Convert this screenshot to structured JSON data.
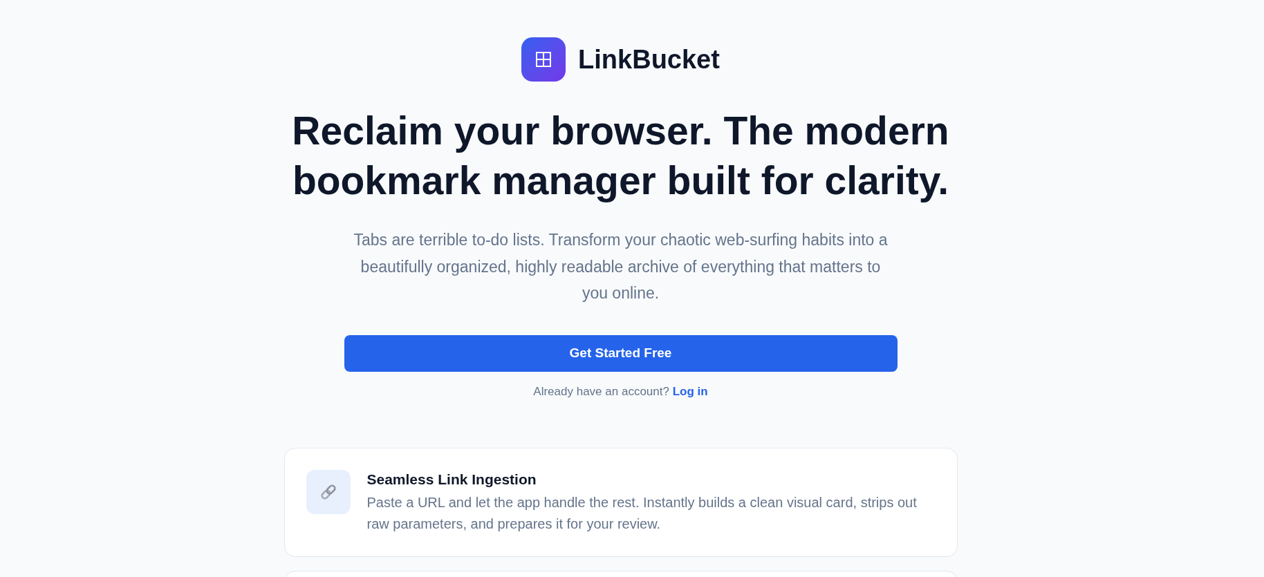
{
  "brand": {
    "name": "LinkBucket"
  },
  "hero": {
    "headline": "Reclaim your browser. The modern bookmark manager built for clarity.",
    "subtitle": "Tabs are terrible to-do lists. Transform your chaotic web-surfing habits into a beautifully organized, highly readable archive of everything that matters to you online.",
    "cta": "Get Started Free",
    "login_prompt": "Already have an account?",
    "login_link": "Log in"
  },
  "features": [
    {
      "title": "Seamless Link Ingestion",
      "description": "Paste a URL and let the app handle the rest. Instantly builds a clean visual card, strips out raw parameters, and prepares it for your review."
    }
  ]
}
